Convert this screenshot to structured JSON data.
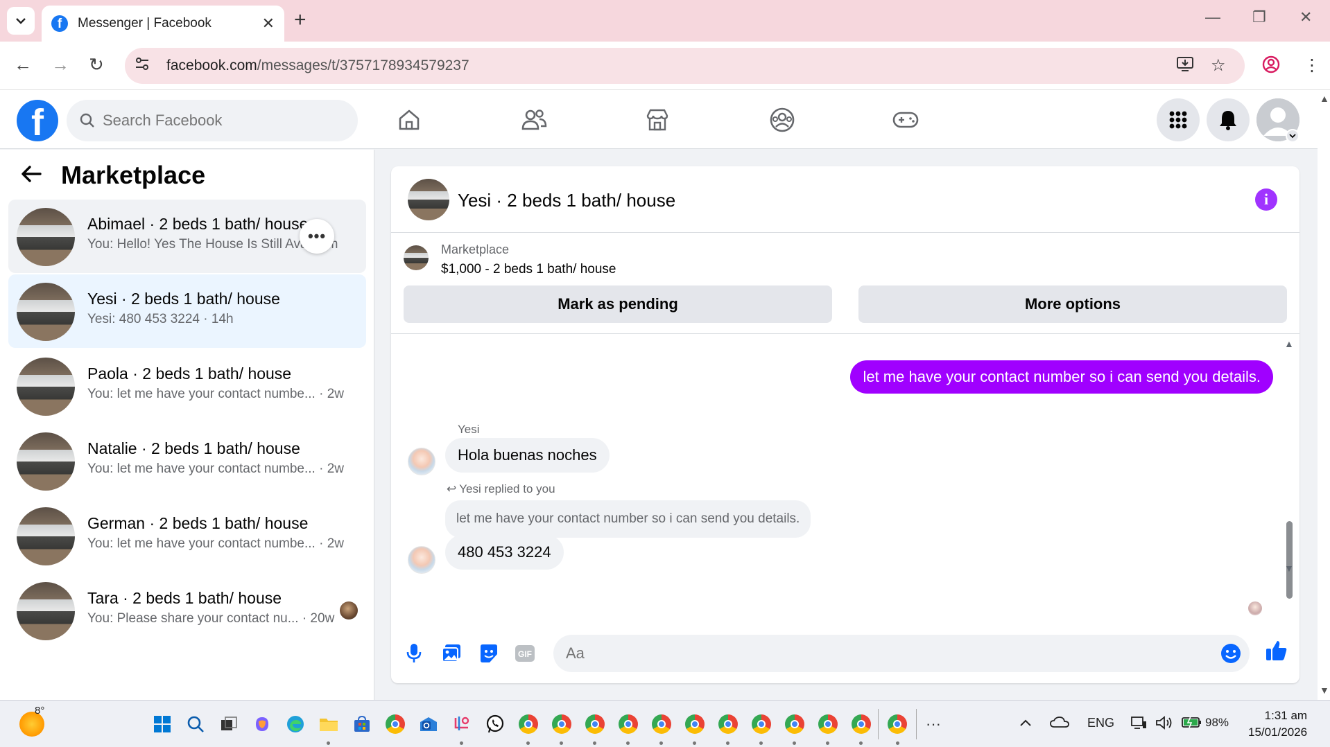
{
  "browser": {
    "tab_title": "Messenger | Facebook",
    "url_host": "facebook.com",
    "url_path": "/messages/t/3757178934579237"
  },
  "fb": {
    "search_placeholder": "Search Facebook"
  },
  "left_panel": {
    "title": "Marketplace",
    "conversations": [
      {
        "name": "Abimael · 2 beds 1 bath/ house",
        "preview": "You: Hello! Yes The House Is Still Ava",
        "preview_tail": "m"
      },
      {
        "name": "Yesi · 2 beds 1 bath/ house",
        "preview": "Yesi: 480 453 3224 · 14h"
      },
      {
        "name": "Paola · 2 beds 1 bath/ house",
        "preview": "You: let me have your contact numbe... · 2w"
      },
      {
        "name": "Natalie · 2 beds 1 bath/ house",
        "preview": "You: let me have your contact numbe... · 2w"
      },
      {
        "name": "German · 2 beds 1 bath/ house",
        "preview": "You: let me have your contact numbe... · 2w"
      },
      {
        "name": "Tara · 2 beds 1 bath/ house",
        "preview": "You: Please share your contact nu... · 20w"
      }
    ]
  },
  "chat": {
    "title": "Yesi · 2 beds 1 bath/ house",
    "listing_source": "Marketplace",
    "listing_price": "$1,000 - 2 beds 1 bath/ house",
    "mark_pending_label": "Mark as pending",
    "more_options_label": "More options",
    "outgoing_message": "let me have your contact number so i can send you details.",
    "sender_name": "Yesi",
    "incoming_message_1": "Hola buenas noches",
    "reply_note": "Yesi replied to you",
    "quoted_message": "let me have your contact number so i can send you details.",
    "incoming_message_2": "480 453 3224",
    "composer_placeholder": "Aa"
  },
  "taskbar": {
    "temperature": "8°",
    "language": "ENG",
    "battery": "98%",
    "time": "1:31 am",
    "date": "15/01/2026"
  },
  "colors": {
    "brand": "#1877f2",
    "outgoing_bubble": "#a000ff",
    "info_icon": "#a033ff"
  }
}
